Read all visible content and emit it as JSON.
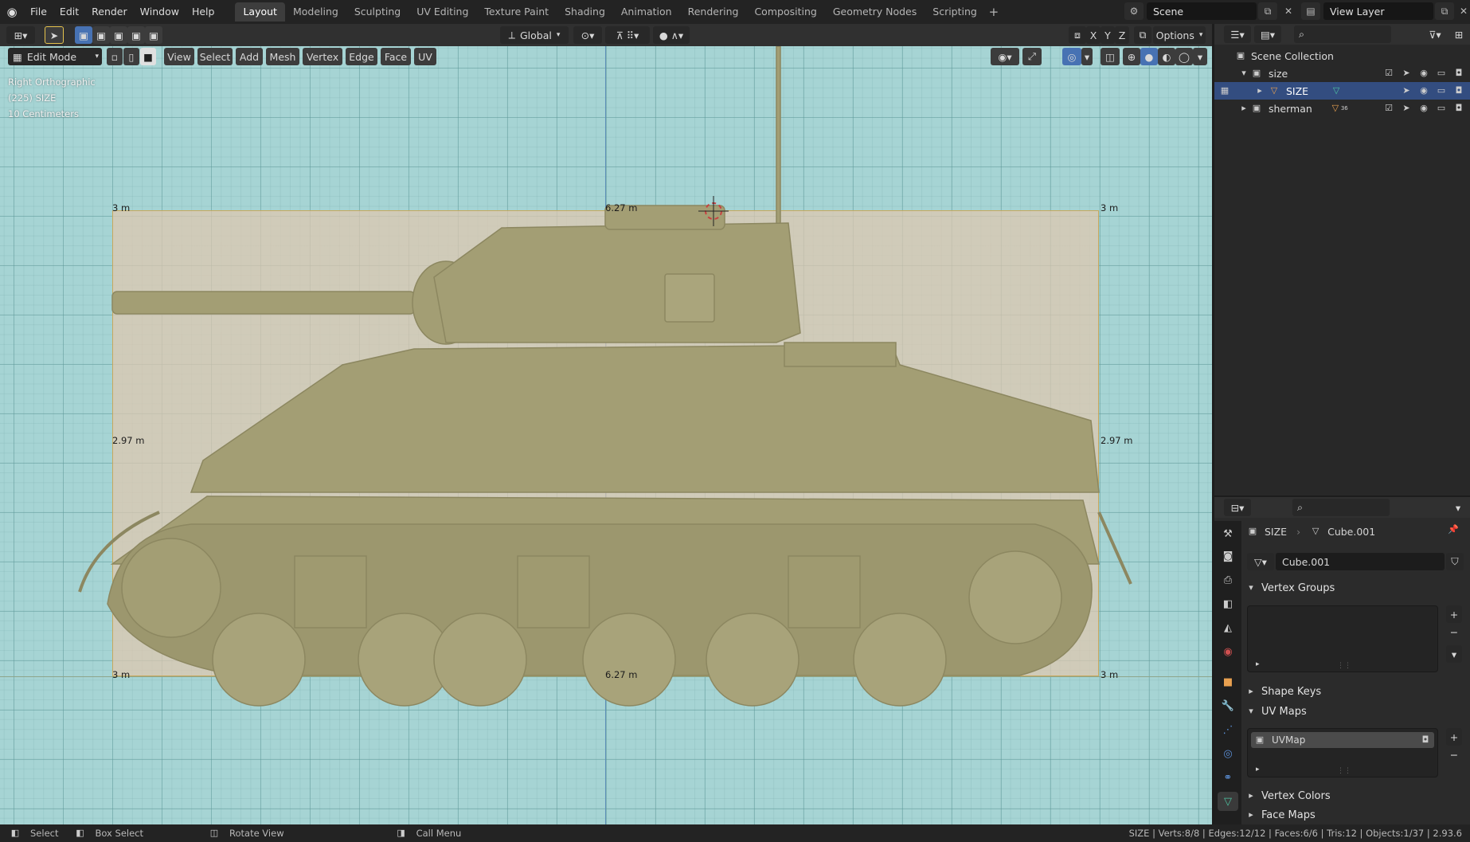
{
  "menu": [
    "File",
    "Edit",
    "Render",
    "Window",
    "Help"
  ],
  "workspaces": [
    "Layout",
    "Modeling",
    "Sculpting",
    "UV Editing",
    "Texture Paint",
    "Shading",
    "Animation",
    "Rendering",
    "Compositing",
    "Geometry Nodes",
    "Scripting"
  ],
  "active_workspace": "Layout",
  "scene_name": "Scene",
  "view_layer": "View Layer",
  "header": {
    "transform_orientation": "Global",
    "options_label": "Options",
    "mode": "Edit Mode",
    "menus": [
      "View",
      "Select",
      "Add",
      "Mesh",
      "Vertex",
      "Edge",
      "Face",
      "UV"
    ],
    "axes": [
      "X",
      "Y",
      "Z"
    ]
  },
  "viewport": {
    "view_name": "Right Orthographic",
    "object_info": "(225) SIZE",
    "scale": "10 Centimeters",
    "dims": {
      "top_left": "3 m",
      "top_center": "6.27 m",
      "top_right": "3 m",
      "mid_left": "2.97 m",
      "mid_right": "2.97 m",
      "bottom_left": "3 m",
      "bottom_center": "6.27 m",
      "bottom_right": "3 m"
    }
  },
  "outliner": {
    "root": "Scene Collection",
    "items": [
      {
        "name": "size",
        "type": "collection"
      },
      {
        "name": "SIZE",
        "type": "mesh",
        "selected": true
      },
      {
        "name": "sherman",
        "type": "collection",
        "badge": "36"
      }
    ]
  },
  "properties": {
    "object_name": "SIZE",
    "mesh_name": "Cube.001",
    "data_block": "Cube.001",
    "panels": {
      "vertex_groups": "Vertex Groups",
      "shape_keys": "Shape Keys",
      "uv_maps": "UV Maps",
      "vertex_colors": "Vertex Colors",
      "face_maps": "Face Maps"
    },
    "uv_map_item": "UVMap"
  },
  "statusbar": {
    "select": "Select",
    "box_select": "Box Select",
    "rotate": "Rotate View",
    "call_menu": "Call Menu",
    "stats": "SIZE | Verts:8/8 | Edges:12/12 | Faces:6/6 | Tris:12 | Objects:1/37 | 2.93.6"
  },
  "colors": {
    "viewport_bg": "#a6d4d4",
    "selection_blue": "#334d80",
    "accent": "#4772b3",
    "tank": "#a39e74"
  }
}
